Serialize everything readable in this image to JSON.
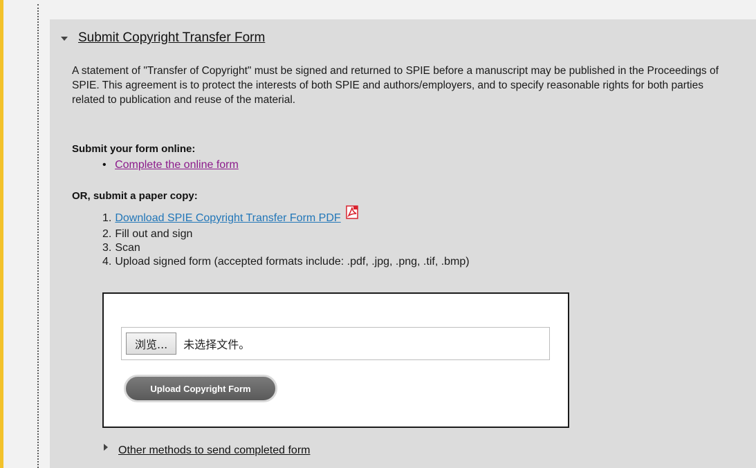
{
  "header": {
    "title": "Submit Copyright Transfer Form"
  },
  "intro": {
    "text": "A statement of \"Transfer of Copyright\" must be signed and returned to SPIE before a manuscript may be published in the Proceedings of SPIE. This agreement is to protect the interests of both SPIE and authors/employers, and to specify reasonable rights for both parties related to publication and reuse of the material."
  },
  "online": {
    "heading": "Submit your form online:",
    "bullet": "•",
    "link_label": "Complete the online form"
  },
  "paper": {
    "heading": "OR, submit a paper copy:",
    "steps": [
      {
        "num": "1.",
        "label": "Download SPIE Copyright Transfer Form PDF"
      },
      {
        "num": "2.",
        "label": "Fill out and sign"
      },
      {
        "num": "3.",
        "label": "Scan"
      },
      {
        "num": "4.",
        "label": "Upload signed form (accepted formats include: .pdf, .jpg, .png, .tif, .bmp)"
      }
    ]
  },
  "upload": {
    "browse_label": "浏览...",
    "file_status": "未选择文件。",
    "upload_button": "Upload Copyright Form"
  },
  "other": {
    "label": "Other methods to send completed form"
  },
  "icons": {
    "pdf": "pdf-icon",
    "expand": "caret-down-icon",
    "collapse": "caret-right-icon"
  },
  "colors": {
    "accent_yellow": "#f3c22b",
    "visited_link": "#8b1a8b",
    "link_blue": "#2176b8",
    "panel_bg": "#dcdcdc",
    "pdf_red": "#d9232e"
  }
}
